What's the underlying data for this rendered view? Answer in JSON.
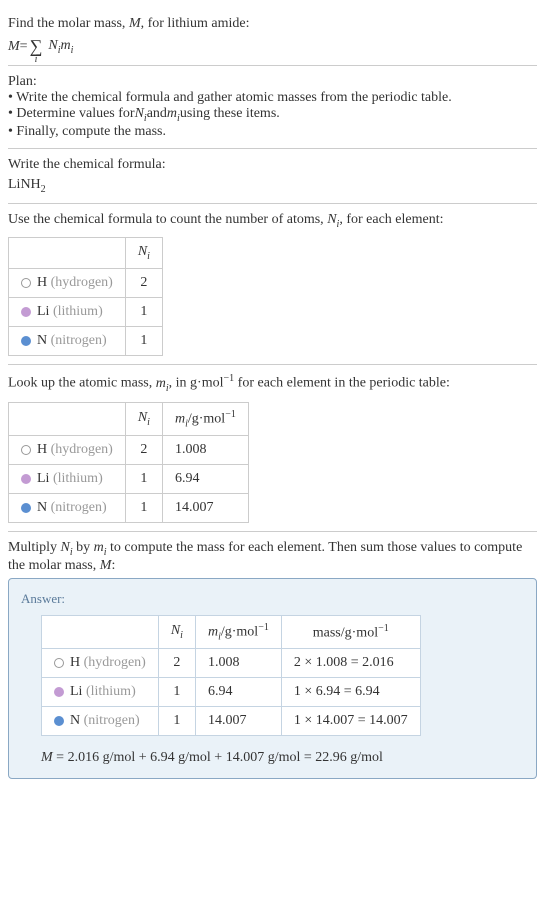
{
  "intro": {
    "line1": "Find the molar mass, ",
    "var_M": "M",
    "line1b": ", for lithium amide:",
    "eq_M": "M",
    "eq_eq": " = ",
    "eq_sigma": "∑",
    "eq_sigma_sub": "i",
    "eq_Ni": "N",
    "eq_Ni_sub": "i",
    "eq_mi": "m",
    "eq_mi_sub": "i"
  },
  "plan": {
    "title": "Plan:",
    "item1_pre": "• Write the chemical formula and gather atomic masses from the periodic table.",
    "item2_a": "• Determine values for ",
    "item2_Ni": "N",
    "item2_Ni_sub": "i",
    "item2_b": " and ",
    "item2_mi": "m",
    "item2_mi_sub": "i",
    "item2_c": " using these items.",
    "item3": "• Finally, compute the mass."
  },
  "chem": {
    "title": "Write the chemical formula:",
    "formula_a": "LiNH",
    "formula_sub": "2"
  },
  "count": {
    "title_a": "Use the chemical formula to count the number of atoms, ",
    "title_Ni": "N",
    "title_Ni_sub": "i",
    "title_b": ", for each element:",
    "hdr_Ni": "N",
    "hdr_Ni_sub": "i",
    "rows": [
      {
        "sym": "H",
        "name": "(hydrogen)",
        "dot": "dot-h",
        "n": "2"
      },
      {
        "sym": "Li",
        "name": "(lithium)",
        "dot": "dot-li",
        "n": "1"
      },
      {
        "sym": "N",
        "name": "(nitrogen)",
        "dot": "dot-n",
        "n": "1"
      }
    ]
  },
  "lookup": {
    "title_a": "Look up the atomic mass, ",
    "title_mi": "m",
    "title_mi_sub": "i",
    "title_b": ", in g·mol",
    "title_sup": "−1",
    "title_c": " for each element in the periodic table:",
    "hdr_Ni": "N",
    "hdr_Ni_sub": "i",
    "hdr_mi": "m",
    "hdr_mi_sub": "i",
    "hdr_unit": "/g·mol",
    "hdr_sup": "−1",
    "rows": [
      {
        "sym": "H",
        "name": "(hydrogen)",
        "dot": "dot-h",
        "n": "2",
        "m": "1.008"
      },
      {
        "sym": "Li",
        "name": "(lithium)",
        "dot": "dot-li",
        "n": "1",
        "m": "6.94"
      },
      {
        "sym": "N",
        "name": "(nitrogen)",
        "dot": "dot-n",
        "n": "1",
        "m": "14.007"
      }
    ]
  },
  "multiply": {
    "text_a": "Multiply ",
    "text_Ni": "N",
    "text_Ni_sub": "i",
    "text_b": " by ",
    "text_mi": "m",
    "text_mi_sub": "i",
    "text_c": " to compute the mass for each element. Then sum those values to compute the molar mass, ",
    "text_M": "M",
    "text_d": ":"
  },
  "answer": {
    "label": "Answer:",
    "hdr_Ni": "N",
    "hdr_Ni_sub": "i",
    "hdr_mi": "m",
    "hdr_mi_sub": "i",
    "hdr_miunit": "/g·mol",
    "hdr_sup": "−1",
    "hdr_mass": "mass/g·mol",
    "rows": [
      {
        "sym": "H",
        "name": "(hydrogen)",
        "dot": "dot-h",
        "n": "2",
        "m": "1.008",
        "calc": "2 × 1.008 = 2.016"
      },
      {
        "sym": "Li",
        "name": "(lithium)",
        "dot": "dot-li",
        "n": "1",
        "m": "6.94",
        "calc": "1 × 6.94 = 6.94"
      },
      {
        "sym": "N",
        "name": "(nitrogen)",
        "dot": "dot-n",
        "n": "1",
        "m": "14.007",
        "calc": "1 × 14.007 = 14.007"
      }
    ],
    "final_M": "M",
    "final_text": " = 2.016 g/mol + 6.94 g/mol + 14.007 g/mol = 22.96 g/mol"
  }
}
